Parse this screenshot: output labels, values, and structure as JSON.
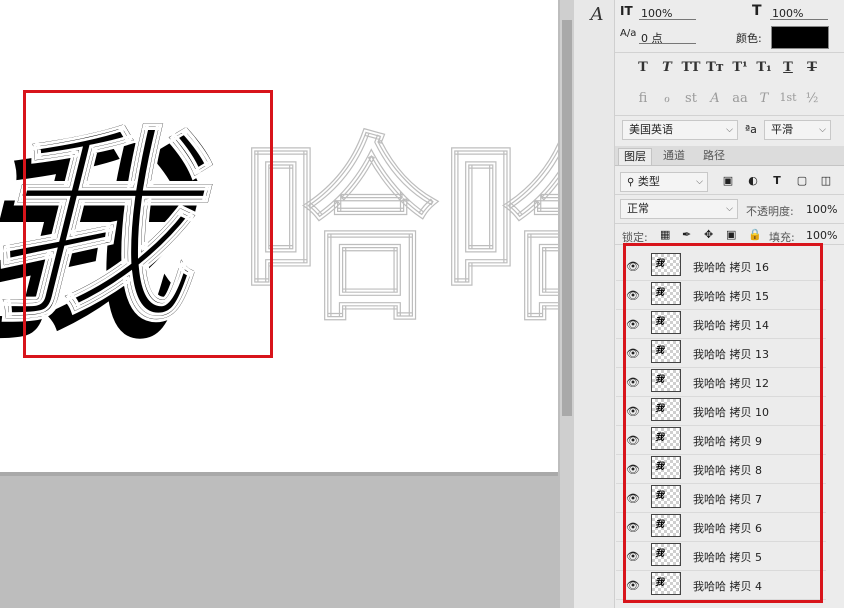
{
  "canvas": {
    "text_solid": "我",
    "text_outline": "哈哈"
  },
  "character_panel": {
    "tool_icon": "A",
    "vscale_icon": "IT",
    "vertical_scale": "100%",
    "hscale_icon": "T",
    "horizontal_scale": "100%",
    "baseline_icon": "A/a",
    "baseline_shift": "0 点",
    "color_label": "颜色:",
    "color_value": "#000000",
    "style_buttons": [
      "T",
      "T",
      "TT",
      "Tт",
      "T¹",
      "T₁",
      "T",
      "T"
    ],
    "opentype_buttons": [
      "fi",
      "ℴ",
      "st",
      "A",
      "aa",
      "T",
      "1st",
      "½"
    ],
    "language": "美国英语",
    "aa_icon": "ªa",
    "antialias": "平滑"
  },
  "layers_panel": {
    "tabs": [
      {
        "label": "图层"
      },
      {
        "label": "通道"
      },
      {
        "label": "路径"
      }
    ],
    "filter_type": "类型",
    "blend_mode": "正常",
    "opacity_label": "不透明度:",
    "opacity_value": "100%",
    "lock_label": "锁定:",
    "fill_label": "填充:",
    "fill_value": "100%",
    "thumb_glyph": "我",
    "layers": [
      {
        "name": "我哈哈 拷贝 16"
      },
      {
        "name": "我哈哈 拷贝 15"
      },
      {
        "name": "我哈哈 拷贝 14"
      },
      {
        "name": "我哈哈 拷贝 13"
      },
      {
        "name": "我哈哈 拷贝 12"
      },
      {
        "name": "我哈哈 拷贝 10"
      },
      {
        "name": "我哈哈 拷贝 9"
      },
      {
        "name": "我哈哈 拷贝 8"
      },
      {
        "name": "我哈哈 拷贝 7"
      },
      {
        "name": "我哈哈 拷贝 6"
      },
      {
        "name": "我哈哈 拷贝 5"
      },
      {
        "name": "我哈哈 拷贝 4"
      }
    ]
  },
  "colors": {
    "highlight": "#d8141b",
    "panel_bg": "#ececec"
  }
}
